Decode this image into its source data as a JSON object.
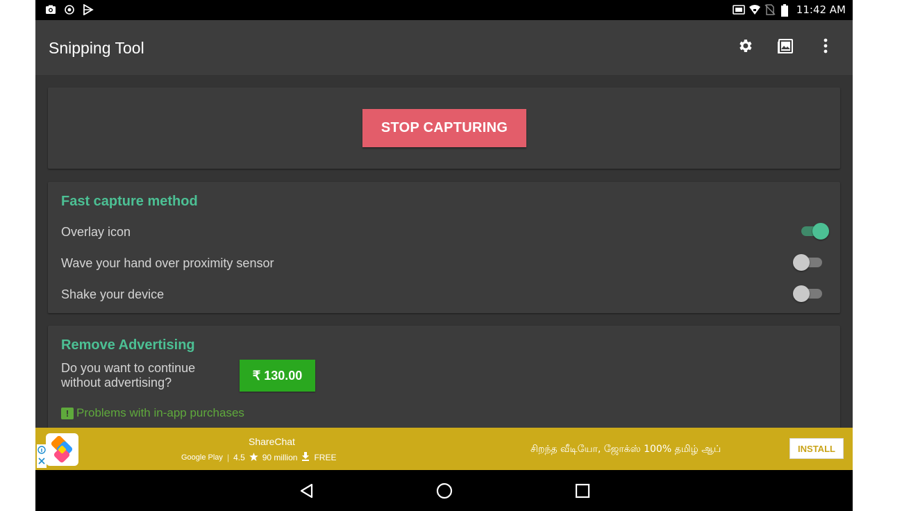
{
  "status_bar": {
    "time": "11:42 AM",
    "left_icons": [
      "camera-icon",
      "shield-icon",
      "play-store-icon"
    ],
    "right_icons": [
      "cast-icon",
      "wifi-icon",
      "no-sim-icon",
      "battery-icon"
    ]
  },
  "app_bar": {
    "title": "Snipping Tool",
    "actions": [
      "settings-icon",
      "gallery-icon",
      "more-vert-icon"
    ]
  },
  "capture_card": {
    "stop_label": "STOP CAPTURING",
    "stop_color": "#e35d6a"
  },
  "fast_capture": {
    "title": "Fast capture method",
    "options": [
      {
        "label": "Overlay icon",
        "enabled": true
      },
      {
        "label": "Wave your hand over proximity sensor",
        "enabled": false
      },
      {
        "label": "Shake your device",
        "enabled": false
      }
    ],
    "accent": "#4cc094"
  },
  "remove_ads": {
    "title": "Remove Advertising",
    "question_line1": "Do you want to continue",
    "question_line2": "without advertising?",
    "price": "₹ 130.00",
    "problems_link": "Problems with in-app purchases"
  },
  "ad": {
    "app_name": "ShareChat",
    "store": "Google Play",
    "rating": "4.5",
    "downloads": "90 million",
    "price": "FREE",
    "tagline": "சிறந்த வீடியோ, ஜோக்ஸ் 100% தமிழ் ஆப்",
    "install_label": "INSTALL",
    "background": "#ccab1a"
  },
  "nav_bar": {
    "buttons": [
      "back-icon",
      "home-icon",
      "recents-icon"
    ]
  }
}
